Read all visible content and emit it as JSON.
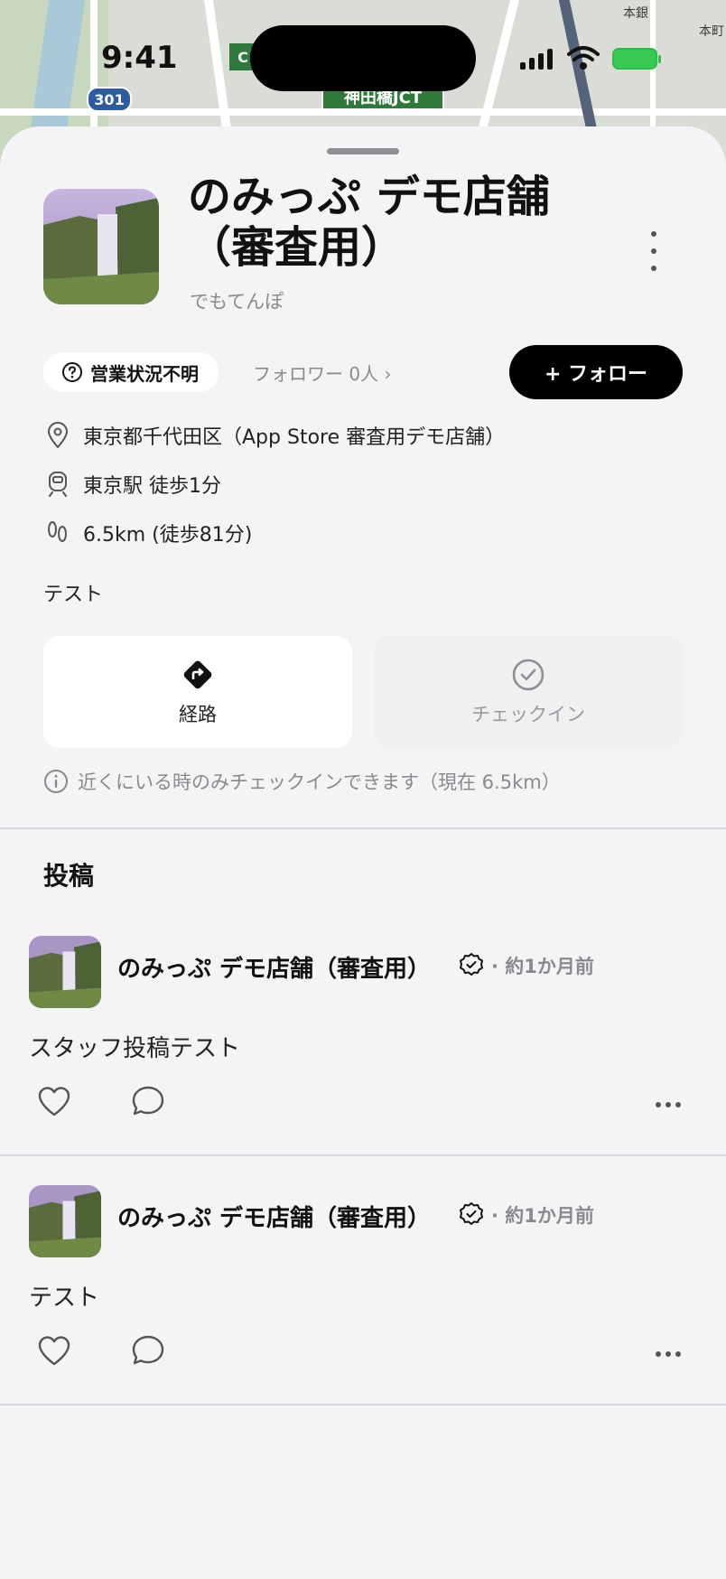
{
  "status_bar": {
    "time": "9:41"
  },
  "map": {
    "route_number": "301",
    "junction_label": "神田橋JCT",
    "tag_letter": "C",
    "area_label_1": "本銀",
    "area_label_2": "本町"
  },
  "store": {
    "name": "のみっぷ デモ店舗（審査用）",
    "kana": "でもてんぽ",
    "business_status": "営業状況不明",
    "followers": "フォロワー 0人 ›",
    "follow_button": "+ フォロー",
    "address": "東京都千代田区（App Store 審査用デモ店舗）",
    "station": "東京駅 徒歩1分",
    "distance": "6.5km (徒歩81分)",
    "description": "テスト"
  },
  "actions": {
    "route_label": "経路",
    "checkin_label": "チェックイン",
    "checkin_note": "近くにいる時のみチェックインできます（現在 6.5km）"
  },
  "posts_section": {
    "title": "投稿",
    "items": [
      {
        "author": "のみっぷ デモ店舗（審査用）",
        "time": "· 約1か月前",
        "body": "スタッフ投稿テスト"
      },
      {
        "author": "のみっぷ デモ店舗（審査用）",
        "time": "· 約1か月前",
        "body": "テスト"
      }
    ]
  },
  "colors": {
    "accent_black": "#000000",
    "battery_green": "#38c853",
    "sheet_bg": "#f4f4f6"
  },
  "icons": [
    "question-circle-icon",
    "location-pin-icon",
    "train-icon",
    "footprints-icon",
    "route-diamond-icon",
    "check-circle-icon",
    "info-circle-icon",
    "verified-badge-icon",
    "heart-icon",
    "comment-icon",
    "more-horizontal-icon",
    "more-vertical-icon"
  ]
}
